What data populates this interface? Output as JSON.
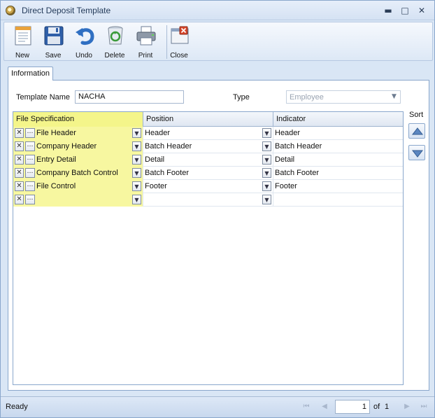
{
  "window": {
    "title": "Direct Deposit Template",
    "minimize": "▬",
    "maximize": "□",
    "close": "✕"
  },
  "toolbar": {
    "new_label": "New",
    "save_label": "Save",
    "undo_label": "Undo",
    "delete_label": "Delete",
    "print_label": "Print",
    "close_label": "Close"
  },
  "tabs": [
    {
      "label": "Information"
    }
  ],
  "form": {
    "template_name_label": "Template Name",
    "template_name_value": "NACHA",
    "type_label": "Type",
    "type_value": "Employee"
  },
  "grid": {
    "columns": [
      "File Specification",
      "Position",
      "Indicator"
    ],
    "rows": [
      {
        "file_spec": "File Header",
        "position": "Header",
        "indicator": "Header"
      },
      {
        "file_spec": "Company Header",
        "position": "Batch Header",
        "indicator": "Batch Header"
      },
      {
        "file_spec": "Entry Detail",
        "position": "Detail",
        "indicator": "Detail"
      },
      {
        "file_spec": "Company Batch Control",
        "position": "Batch Footer",
        "indicator": "Batch Footer"
      },
      {
        "file_spec": "File Control",
        "position": "Footer",
        "indicator": "Footer"
      },
      {
        "file_spec": "",
        "position": "",
        "indicator": ""
      }
    ]
  },
  "sort": {
    "label": "Sort"
  },
  "status": {
    "text": "Ready",
    "page": "1",
    "of": "of",
    "total": "1"
  },
  "icons": {
    "new": "new-document-icon",
    "save": "floppy-disk-icon",
    "undo": "undo-arrow-icon",
    "delete": "recycle-bin-icon",
    "print": "printer-icon",
    "close": "close-window-icon"
  },
  "colors": {
    "highlight": "#f7f7a0",
    "frame": "#8aa7cc",
    "undo_blue": "#2f6fc2"
  }
}
